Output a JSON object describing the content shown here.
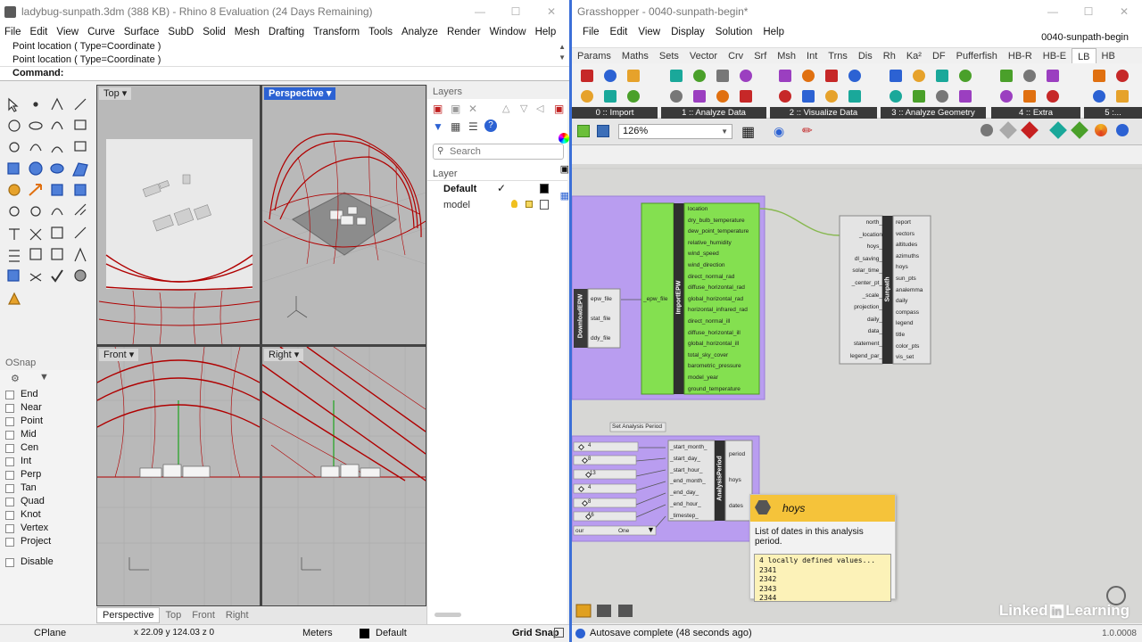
{
  "rhino": {
    "title": "ladybug-sunpath.3dm (388 KB) - Rhino 8 Evaluation (24 Days Remaining)",
    "menu": [
      "File",
      "Edit",
      "View",
      "Curve",
      "Surface",
      "SubD",
      "Solid",
      "Mesh",
      "Drafting",
      "Transform",
      "Tools",
      "Analyze",
      "Render",
      "Window",
      "Help"
    ],
    "command_history": [
      "Point location ( Type=Coordinate )",
      "Point location ( Type=Coordinate )"
    ],
    "command_prompt": "Command:",
    "viewports": {
      "top": "Top",
      "perspective": "Perspective",
      "front": "Front",
      "right": "Right"
    },
    "viewport_tabs": [
      "Perspective",
      "Top",
      "Front",
      "Right"
    ],
    "layers_panel": {
      "title": "Layers",
      "search_placeholder": "Search",
      "column": "Layer",
      "layers": [
        {
          "name": "Default",
          "current": true,
          "color": "#000000"
        },
        {
          "name": "model",
          "current": false,
          "color": "#ffffff"
        }
      ]
    },
    "osnap": {
      "title": "OSnap",
      "items": [
        "End",
        "Near",
        "Point",
        "Mid",
        "Cen",
        "Int",
        "Perp",
        "Tan",
        "Quad",
        "Knot",
        "Vertex",
        "Project"
      ],
      "disable": "Disable"
    },
    "status": {
      "cplane": "CPlane",
      "coords": "x 22.09    y 124.03    z 0",
      "units": "Meters",
      "layer": "Default",
      "grid_snap": "Grid Snap"
    }
  },
  "grasshopper": {
    "title": "Grasshopper - 0040-sunpath-begin*",
    "document_name": "0040-sunpath-begin",
    "menu": [
      "File",
      "Edit",
      "View",
      "Display",
      "Solution",
      "Help"
    ],
    "tabs": [
      "Params",
      "Maths",
      "Sets",
      "Vector",
      "Crv",
      "Srf",
      "Msh",
      "Int",
      "Trns",
      "Dis",
      "Rh",
      "Ka²",
      "DF",
      "Pufferfish",
      "HB-R",
      "HB-E",
      "LB",
      "HB"
    ],
    "active_tab": "LB",
    "ribbon_groups": [
      "0 :: Import",
      "1 :: Analyze Data",
      "2 :: Visualize Data",
      "3 :: Analyze Geometry",
      "4 :: Extra",
      "5 :..."
    ],
    "zoom": "126%",
    "components": {
      "download_epw": {
        "name": "DownloadEPW",
        "outputs": [
          "epw_file",
          "stat_file",
          "ddy_file"
        ]
      },
      "import_epw": {
        "name": "ImportEPW",
        "inputs": [
          "_epw_file"
        ],
        "outputs": [
          "location",
          "dry_bulb_temperature",
          "dew_point_temperature",
          "relative_humidity",
          "wind_speed",
          "wind_direction",
          "direct_normal_rad",
          "diffuse_horizontal_rad",
          "global_horizontal_rad",
          "horizontal_infrared_rad",
          "direct_normal_ill",
          "diffuse_horizontal_ill",
          "global_horizontal_ill",
          "total_sky_cover",
          "barometric_pressure",
          "model_year",
          "ground_temperature"
        ]
      },
      "sunpath": {
        "name": "Sunpath",
        "inputs": [
          "north_",
          "_location",
          "hoys_",
          "dl_saving_",
          "solar_time_",
          "_center_pt_",
          "_scale_",
          "projection_",
          "daily_",
          "data_",
          "statement_",
          "legend_par_"
        ],
        "outputs": [
          "report",
          "vectors",
          "altitudes",
          "azimuths",
          "hoys",
          "sun_pts",
          "analemma",
          "daily",
          "compass",
          "legend",
          "title",
          "color_pts",
          "vis_set"
        ]
      },
      "analysis_period": {
        "name": "AnalysisPeriod",
        "group_label": "Set Analysis Period",
        "inputs": [
          "_start_month_",
          "_start_day_",
          "_start_hour_",
          "_end_month_",
          "_end_day_",
          "_end_hour_",
          "_timestep_"
        ],
        "outputs": [
          "period",
          "hoys",
          "dates"
        ],
        "sliders": [
          "4",
          "8",
          "13",
          "4",
          "8",
          "16"
        ],
        "dropdown": "One",
        "dropdown_left": "our"
      }
    },
    "tooltip": {
      "title": "hoys",
      "description": "List of dates in this analysis period.",
      "values_header": "4 locally defined values...",
      "values": [
        "2341",
        "2342",
        "2343",
        "2344"
      ]
    },
    "status": {
      "message": "Autosave complete (48 seconds ago)",
      "version": "1.0.0008"
    },
    "watermark": "Linked in Learning"
  }
}
